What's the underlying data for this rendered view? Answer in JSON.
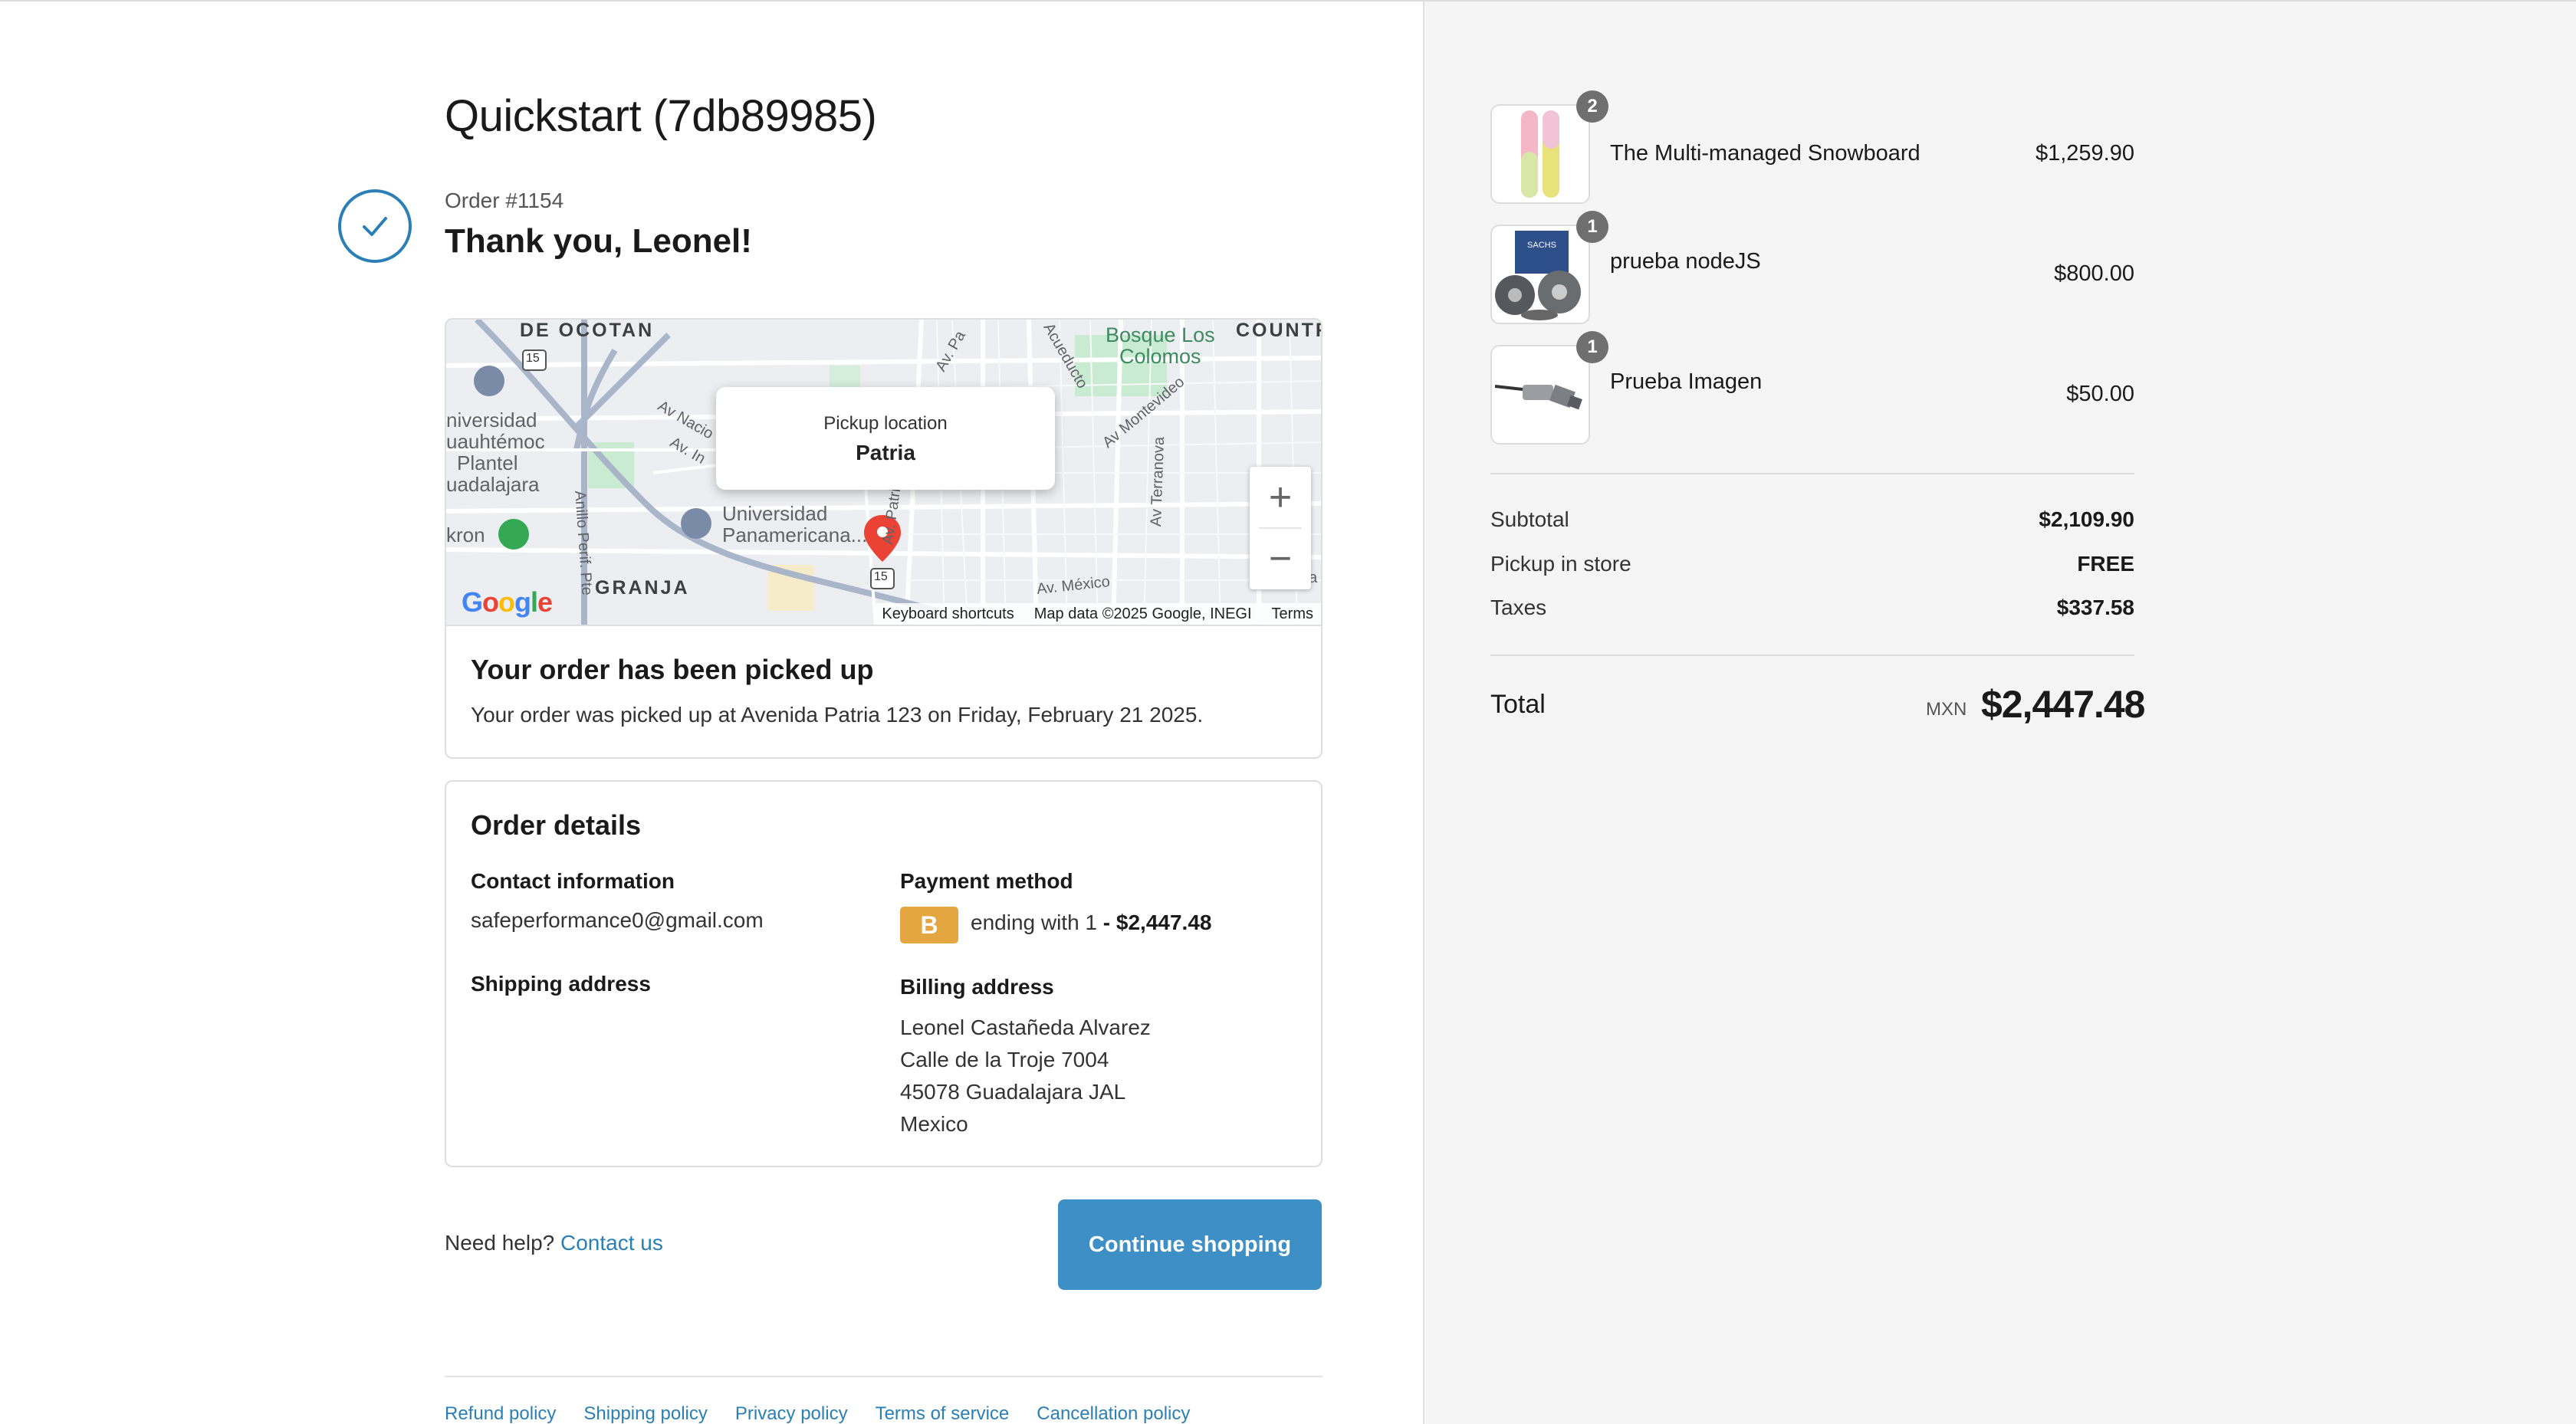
{
  "header": {
    "shop_title": "Quickstart (7db89985)",
    "order_number": "Order #1154",
    "thank_you": "Thank you, Leonel!"
  },
  "map": {
    "popup_label": "Pickup location",
    "popup_name": "Patria",
    "labels": {
      "de_ocotan": "DE OCOTAN",
      "country": "COUNTR",
      "bosque": "Bosque Los",
      "colomos": "Colomos",
      "universidad1": "niversidad",
      "universidad2": "uauhtémoc",
      "universidad3": "Plantel",
      "universidad4": "uadalajara",
      "upan1": "Universidad",
      "upan2": "Panamericana...",
      "akron": "kron",
      "granja": "GRANJA",
      "av_nacional": "Av Nacio",
      "av_in": "Av. In",
      "av_pa": "Av. Pa",
      "acueducto": "Acueducto",
      "montevideo": "Av Montevideo",
      "terranova": "Av Terranova",
      "anillo": "Anillo Perif. Pte",
      "mexico": "Av. México",
      "av_patria": "Av. Patria",
      "road_15a": "15",
      "road_15b": "15",
      "edge_ca": "(Ca"
    },
    "footer": {
      "keyboard": "Keyboard shortcuts",
      "data": "Map data ©2025 Google, INEGI",
      "terms": "Terms"
    },
    "logo": [
      "G",
      "o",
      "o",
      "g",
      "l",
      "e"
    ],
    "zoom_in": "+",
    "zoom_out": "−"
  },
  "pickup": {
    "title": "Your order has been picked up",
    "text": "Your order was picked up at Avenida Patria 123 on Friday, February 21 2025."
  },
  "details": {
    "title": "Order details",
    "contact_heading": "Contact information",
    "contact_email": "safeperformance0@gmail.com",
    "payment_heading": "Payment method",
    "payment_badge": "B",
    "payment_text": "ending with 1",
    "payment_amount": "- $2,447.48",
    "shipping_heading": "Shipping address",
    "billing_heading": "Billing address",
    "billing_lines": [
      "Leonel Castañeda Alvarez",
      "Calle de la Troje 7004",
      "45078 Guadalajara JAL",
      "Mexico"
    ]
  },
  "footer": {
    "help_text": "Need help?",
    "contact_link": "Contact us",
    "continue_button": "Continue shopping",
    "policies": [
      "Refund policy",
      "Shipping policy",
      "Privacy policy",
      "Terms of service",
      "Cancellation policy"
    ]
  },
  "summary": {
    "items": [
      {
        "name": "The Multi-managed Snowboard",
        "price": "$1,259.90",
        "qty": "2",
        "icon": "snowboard-image"
      },
      {
        "name": "prueba nodeJS",
        "price": "$800.00",
        "qty": "1",
        "icon": "clutch-kit-image"
      },
      {
        "name": "Prueba Imagen",
        "price": "$50.00",
        "qty": "1",
        "icon": "oxygen-sensor-image"
      }
    ],
    "subtotal_label": "Subtotal",
    "subtotal_value": "$2,109.90",
    "pickup_label": "Pickup in store",
    "pickup_value": "FREE",
    "taxes_label": "Taxes",
    "taxes_value": "$337.58",
    "total_label": "Total",
    "currency": "MXN",
    "total_value": "$2,447.48"
  },
  "colors": {
    "accent": "#2a7fb7",
    "button": "#3f8fc7",
    "payment_badge": "#e4a641",
    "map_pin": "#ea4335"
  }
}
